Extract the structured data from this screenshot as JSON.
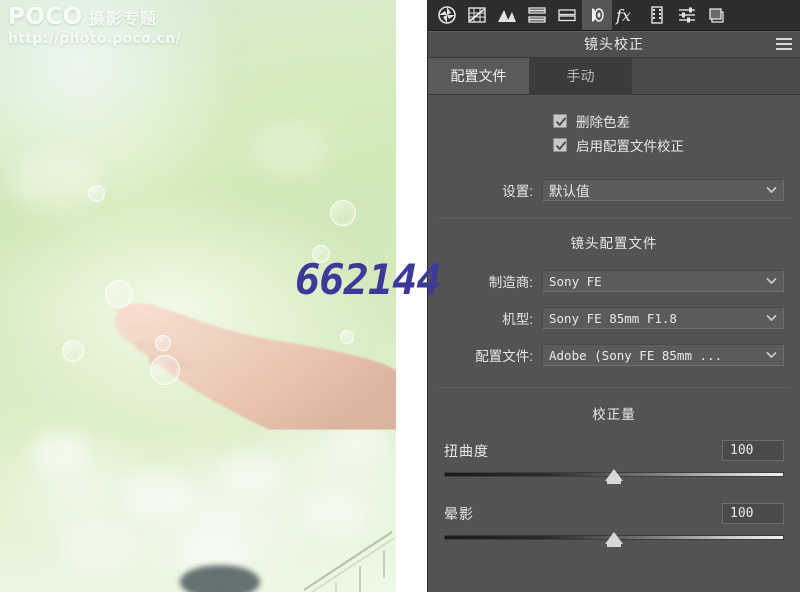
{
  "photo": {
    "watermark_brand": "POCO",
    "watermark_topic": "摄影专题",
    "watermark_url": "http://photo.poco.cn/",
    "overlay_number": "662144",
    "overlay_number_color": "#3c3a98",
    "subject": "hand-with-soap-bubbles-on-green-grass"
  },
  "toolbar": {
    "icons": [
      {
        "name": "basic-adjust-icon",
        "label": "基本"
      },
      {
        "name": "tone-curve-icon",
        "label": "色调曲线"
      },
      {
        "name": "hsl-grayscale-icon",
        "label": "HSL/灰度"
      },
      {
        "name": "split-toning-icon",
        "label": "分离色调"
      },
      {
        "name": "detail-icon",
        "label": "细节"
      },
      {
        "name": "lens-correction-icon",
        "label": "镜头校正"
      },
      {
        "name": "effects-fx-icon",
        "label": "效果"
      },
      {
        "name": "camera-calibration-icon",
        "label": "相机校准"
      },
      {
        "name": "presets-icon",
        "label": "预设"
      },
      {
        "name": "snapshots-icon",
        "label": "快照"
      }
    ],
    "active_index": 5
  },
  "panel": {
    "title": "镜头校正",
    "menu_icon": "hamburger-menu-icon",
    "tabs": [
      {
        "label": "配置文件",
        "active": true
      },
      {
        "label": "手动",
        "active": false
      }
    ],
    "checkboxes": [
      {
        "label": "删除色差",
        "checked": true
      },
      {
        "label": "启用配置文件校正",
        "checked": true
      }
    ],
    "setup": {
      "label": "设置:",
      "value": "默认值"
    },
    "lens_profile": {
      "section_title": "镜头配置文件",
      "fields": [
        {
          "label": "制造商:",
          "value": "Sony FE"
        },
        {
          "label": "机型:",
          "value": "Sony FE 85mm F1.8"
        },
        {
          "label": "配置文件:",
          "value": "Adobe (Sony FE 85mm ..."
        }
      ]
    },
    "correction_amount": {
      "section_title": "校正量",
      "sliders": [
        {
          "name": "扭曲度",
          "value": "100",
          "position_pct": 50
        },
        {
          "name": "晕影",
          "value": "100",
          "position_pct": 50
        }
      ]
    }
  },
  "colors": {
    "panel_bg": "#535353",
    "toolbar_bg": "#2d2d2d",
    "tab_active_bg": "#5a5a5a",
    "tab_inactive_bg": "#3b3b3b",
    "field_bg": "#5b5b5b",
    "text": "#e8e8e8"
  }
}
